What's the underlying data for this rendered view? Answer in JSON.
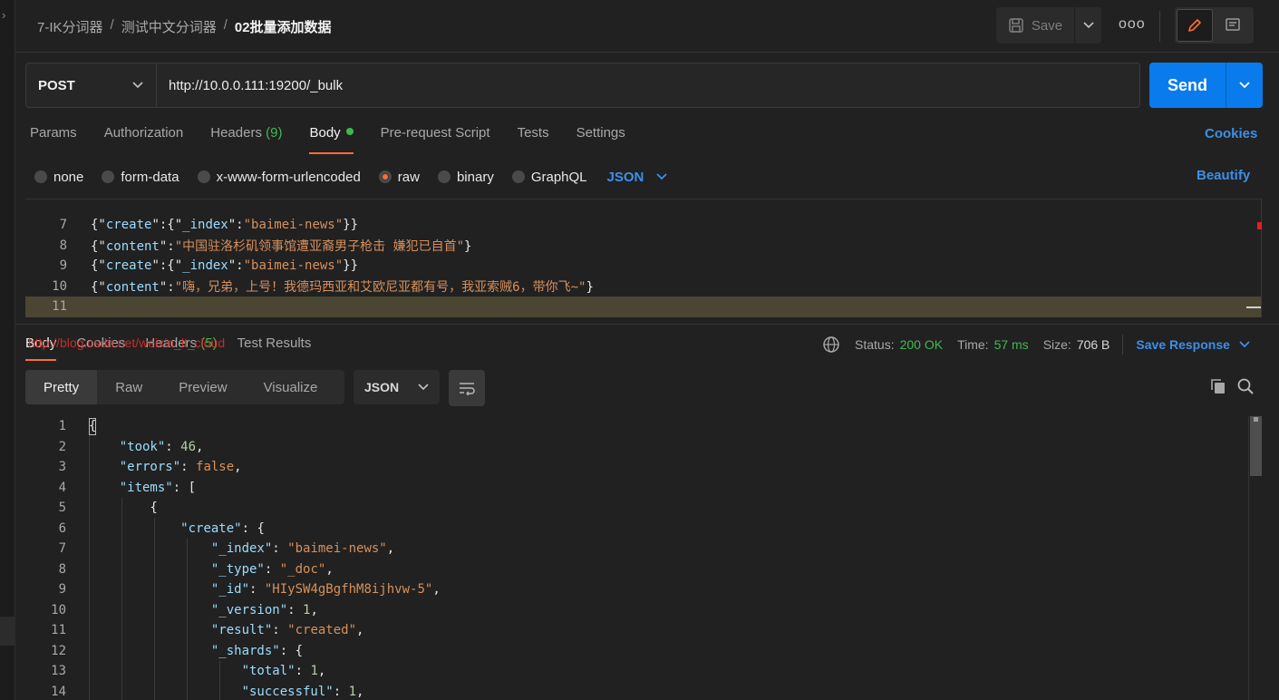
{
  "breadcrumb": {
    "collection": "7-IK分词器",
    "folder": "测试中文分词器",
    "request": "02批量添加数据",
    "separator": "/"
  },
  "header": {
    "save_label": "Save",
    "more_label": "ooo"
  },
  "request": {
    "method": "POST",
    "url": "http://10.0.0.111:19200/_bulk",
    "send_label": "Send"
  },
  "request_tabs": {
    "params": "Params",
    "authorization": "Authorization",
    "headers": "Headers",
    "headers_count": "(9)",
    "body": "Body",
    "pre_request": "Pre-request Script",
    "tests": "Tests",
    "settings": "Settings",
    "cookies": "Cookies"
  },
  "body_types": {
    "none": "none",
    "form_data": "form-data",
    "urlencoded": "x-www-form-urlencoded",
    "raw": "raw",
    "binary": "binary",
    "graphql": "GraphQL",
    "format": "JSON",
    "beautify": "Beautify",
    "selected": "raw"
  },
  "request_body_lines": [
    {
      "n": "7",
      "t": "{\"create\":{\"_index\":\"baimei-news\"}}"
    },
    {
      "n": "8",
      "t": "{\"content\":\"中国驻洛杉矶领事馆遭亚裔男子枪击 嫌犯已自首\"}"
    },
    {
      "n": "9",
      "t": "{\"create\":{\"_index\":\"baimei-news\"}}"
    },
    {
      "n": "10",
      "t": "{\"content\":\"嗨，兄弟，上号！我德玛西亚和艾欧尼亚都有号，我亚索贼6，带你飞~\"}"
    },
    {
      "n": "11",
      "t": ""
    }
  ],
  "response_tabs": {
    "body": "Body",
    "cookies": "Cookies",
    "headers": "Headers",
    "headers_count": "(5)",
    "test_results": "Test Results",
    "watermark": "http://blog.csdn.net/weixin_lt_cloud"
  },
  "response_meta": {
    "status_label": "Status:",
    "status_value": "200 OK",
    "time_label": "Time:",
    "time_value": "57 ms",
    "size_label": "Size:",
    "size_value": "706 B",
    "save_response": "Save Response"
  },
  "response_view": {
    "pretty": "Pretty",
    "raw": "Raw",
    "preview": "Preview",
    "visualize": "Visualize",
    "format": "JSON"
  },
  "response_lines": [
    {
      "n": "1",
      "indent": 0,
      "t": "{"
    },
    {
      "n": "2",
      "indent": 1,
      "t": "\"took\": 46,"
    },
    {
      "n": "3",
      "indent": 1,
      "t": "\"errors\": false,"
    },
    {
      "n": "4",
      "indent": 1,
      "t": "\"items\": ["
    },
    {
      "n": "5",
      "indent": 2,
      "t": "{"
    },
    {
      "n": "6",
      "indent": 3,
      "t": "\"create\": {"
    },
    {
      "n": "7",
      "indent": 4,
      "t": "\"_index\": \"baimei-news\","
    },
    {
      "n": "8",
      "indent": 4,
      "t": "\"_type\": \"_doc\","
    },
    {
      "n": "9",
      "indent": 4,
      "t": "\"_id\": \"HIySW4gBgfhM8ijhvw-5\","
    },
    {
      "n": "10",
      "indent": 4,
      "t": "\"_version\": 1,"
    },
    {
      "n": "11",
      "indent": 4,
      "t": "\"result\": \"created\","
    },
    {
      "n": "12",
      "indent": 4,
      "t": "\"_shards\": {"
    },
    {
      "n": "13",
      "indent": 5,
      "t": "\"total\": 1,"
    },
    {
      "n": "14",
      "indent": 5,
      "t": "\"successful\": 1,"
    }
  ]
}
